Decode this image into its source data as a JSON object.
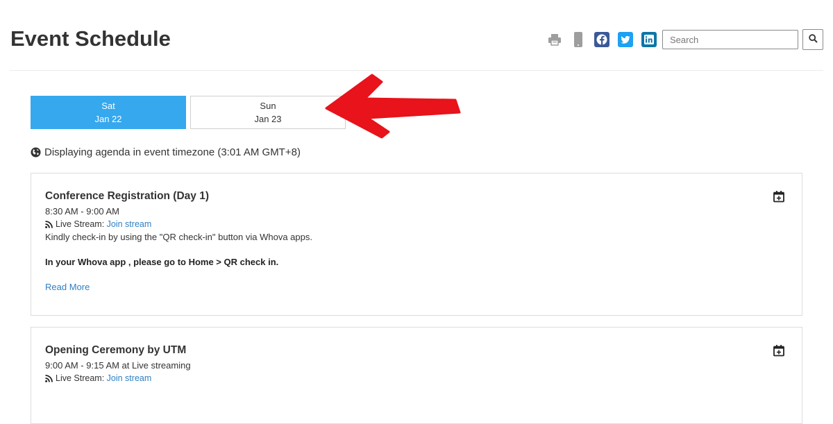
{
  "header": {
    "title": "Event Schedule",
    "search_placeholder": "Search",
    "icons": [
      "print-icon",
      "mobile-icon",
      "facebook-icon",
      "twitter-icon",
      "linkedin-icon",
      "search-icon"
    ]
  },
  "colors": {
    "accent": "#35a8ee",
    "link": "#2f7fc4",
    "facebook": "#3b5998",
    "twitter": "#1da1f2",
    "linkedin": "#0e76a8",
    "annotation_arrow": "#e8131b"
  },
  "days": [
    {
      "weekday": "Sat",
      "date": "Jan 22",
      "active": true
    },
    {
      "weekday": "Sun",
      "date": "Jan 23",
      "active": false
    }
  ],
  "timezone_note": "Displaying agenda in event timezone (3:01 AM GMT+8)",
  "sessions": [
    {
      "title": "Conference Registration (Day 1)",
      "time": "8:30 AM - 9:00 AM",
      "stream_label": "Live Stream:",
      "stream_link": "Join stream",
      "description": "Kindly check-in by using the \"QR check-in\" button via Whova apps.",
      "description_bold": "In your Whova app , please go to Home > QR check in.",
      "read_more": "Read More"
    },
    {
      "title": "Opening Ceremony by UTM",
      "time": "9:00 AM - 9:15 AM at Live streaming",
      "stream_label": "Live Stream:",
      "stream_link": "Join stream"
    }
  ]
}
